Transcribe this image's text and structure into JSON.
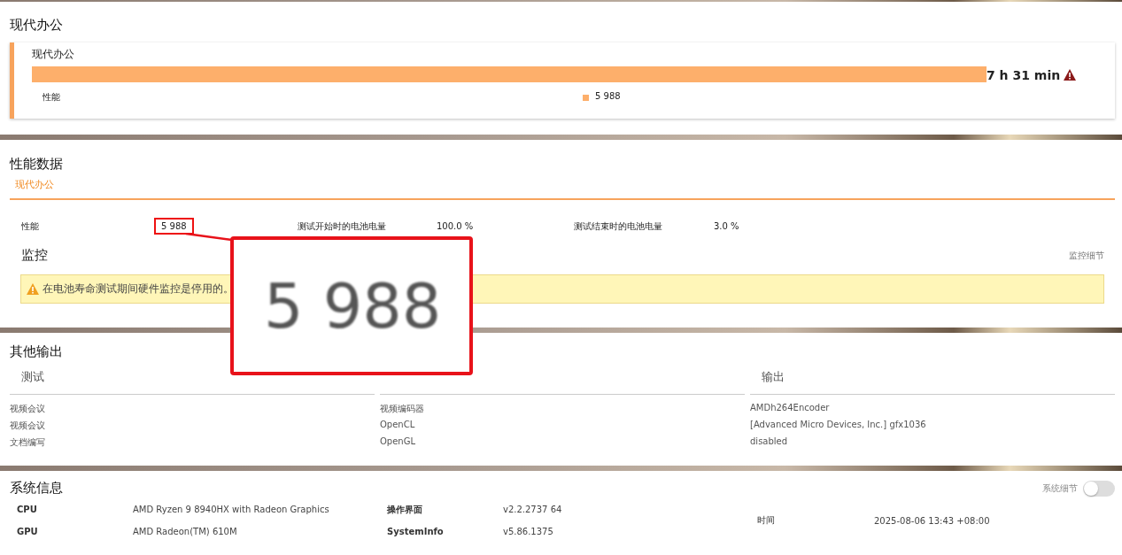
{
  "battery": {
    "title": "现代办公",
    "card": {
      "name": "现代办公",
      "level": 1,
      "duration": "7 h 31 min",
      "warning": true,
      "metric_label": "性能",
      "metric_value": "5 988"
    }
  },
  "performance": {
    "title": "性能数据",
    "tabs": [
      {
        "label": "现代办公",
        "selected": true
      }
    ],
    "metrics": [
      {
        "label": "性能",
        "value": "5 988",
        "highlighted": true
      },
      {
        "label": "测试开始时的电池电量",
        "value": "100.0 %",
        "highlighted": false
      },
      {
        "label": "测试结束时的电池电量",
        "value": "3.0 %",
        "highlighted": false
      }
    ],
    "monitoring": {
      "title": "监控",
      "link": "监控细节",
      "warning": "在电池寿命测试期间硬件监控是停用的。"
    }
  },
  "other_output": {
    "title": "其他输出",
    "columns": [
      "测试",
      null,
      "输出"
    ],
    "rows": [
      [
        "视频会议",
        "视频编码器",
        "AMDh264Encoder"
      ],
      [
        "视频会议",
        "OpenCL",
        "[Advanced Micro Devices, Inc.] gfx1036"
      ],
      [
        "文档编写",
        "OpenGL",
        "disabled"
      ]
    ]
  },
  "system_info": {
    "title": "系统信息",
    "details_label": "系统细节",
    "details_on": false,
    "items": [
      {
        "label": "CPU",
        "value": "AMD Ryzen 9 8940HX with Radeon Graphics"
      },
      {
        "label": "操作界面",
        "value": "v2.2.2737 64"
      },
      {
        "label": "GPU",
        "value": "AMD Radeon(TM) 610M"
      },
      {
        "label": "SystemInfo",
        "value": "v5.86.1375"
      }
    ],
    "time": {
      "label": "时间",
      "value": "2025-08-06 13:43 +08:00"
    }
  },
  "magnifier": {
    "text": "5 988"
  }
}
